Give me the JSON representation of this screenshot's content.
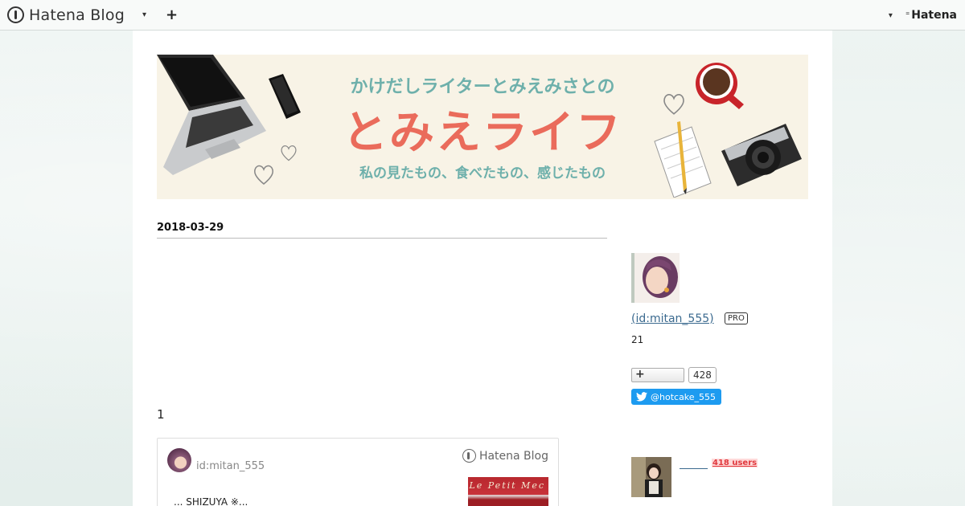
{
  "topbar": {
    "brand": "Hatena Blog",
    "caret_icon": "chevron-down-icon",
    "plus_label": "+",
    "hatena_brand": "Hatena"
  },
  "banner": {
    "subtitle": "かけだしライターとみえみさとの",
    "title": "とみえライフ",
    "tagline": "私の見たもの、食べたもの、感じたもの"
  },
  "article": {
    "date": "2018-03-29",
    "count": "1",
    "card": {
      "user": "id:mitan_555",
      "brand": "Hatena Blog",
      "excerpt": "... SHIZUYA ※...",
      "thumb_text": "Le Petit Mec"
    }
  },
  "sidebar": {
    "user_id": " (id:mitan_555)",
    "pro_badge": "PRO",
    "number": "21",
    "follow_label": "+",
    "follow_count": "428",
    "twitter_label": "@hotcake_555",
    "users_badge": "418 users"
  },
  "colors": {
    "banner_bg": "#f8f3e6",
    "banner_accent": "#6eb0ab",
    "banner_title": "#ea6b5b",
    "link": "#3b6a8f",
    "twitter": "#1d9bf0",
    "users_red": "#e0393e"
  }
}
